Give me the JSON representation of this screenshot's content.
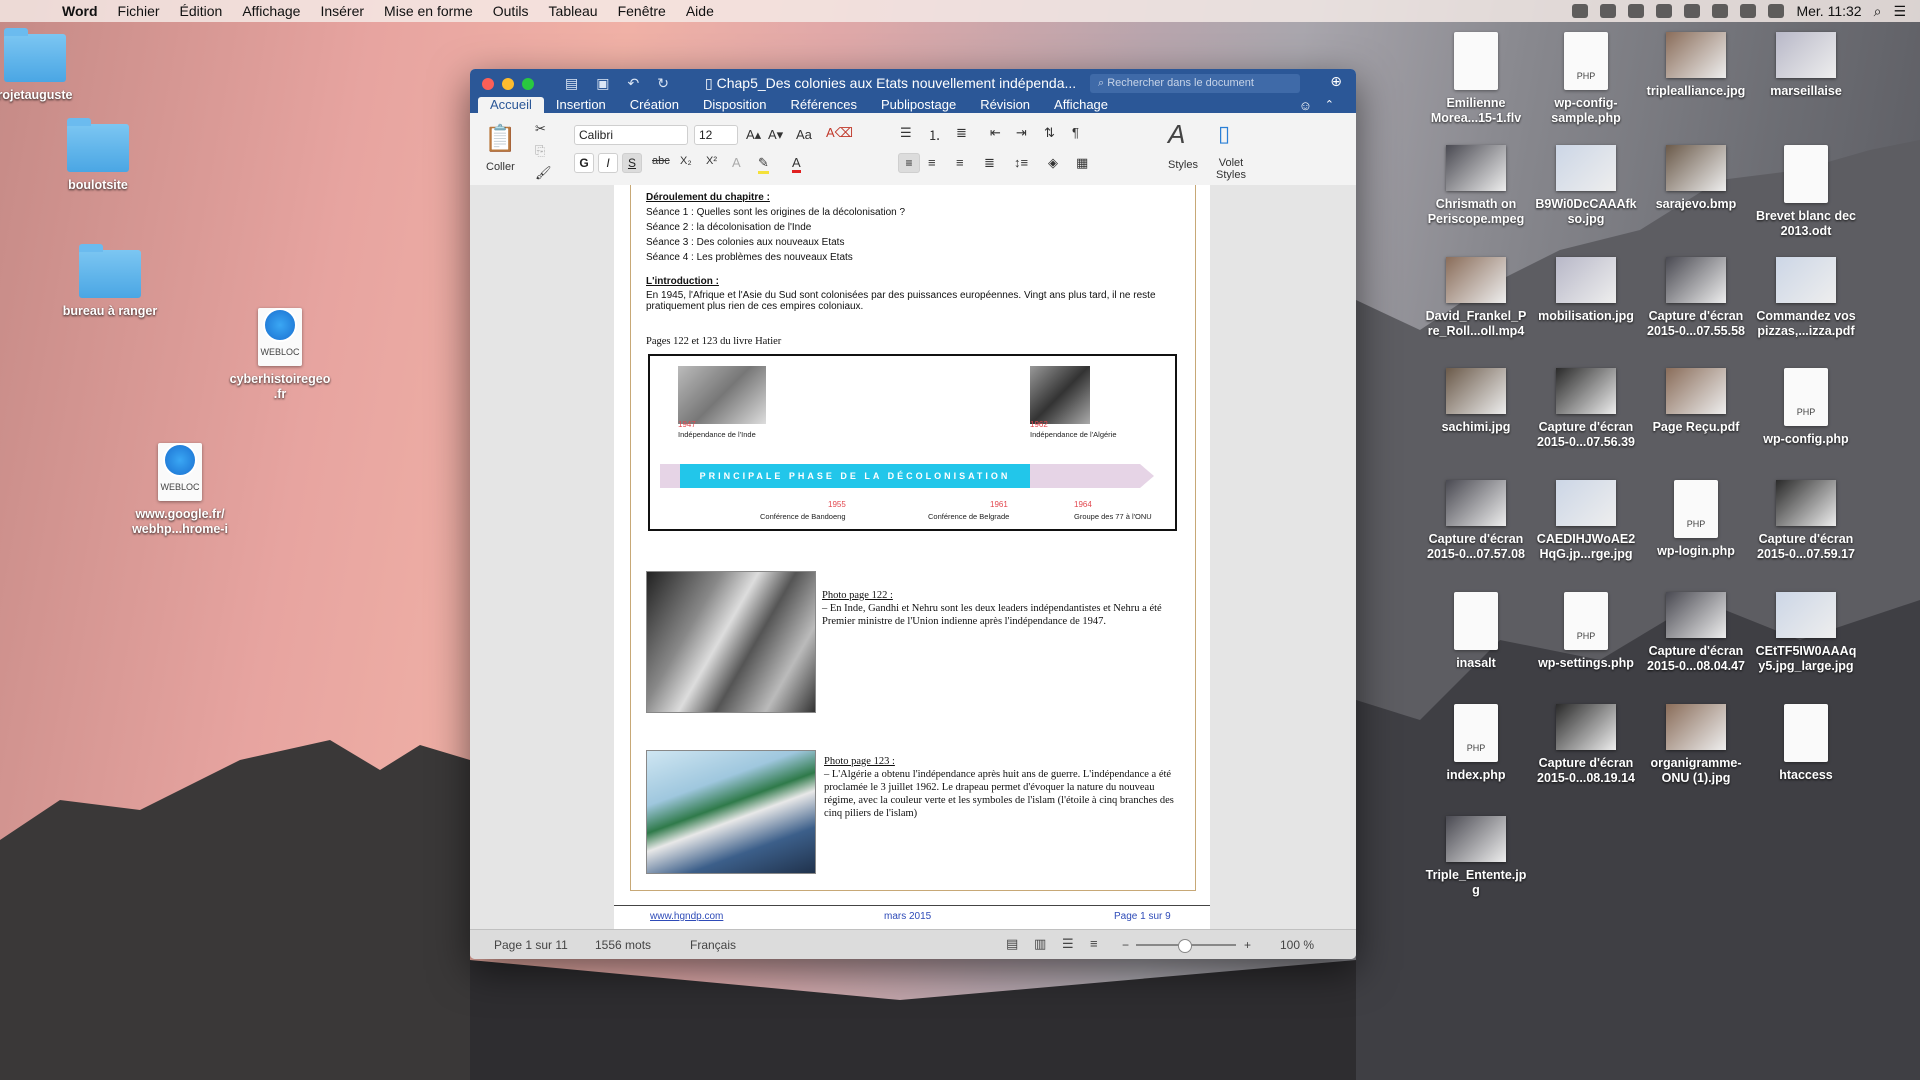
{
  "menubar": {
    "app_name": "Word",
    "items": [
      "Fichier",
      "Édition",
      "Affichage",
      "Insérer",
      "Mise en forme",
      "Outils",
      "Tableau",
      "Fenêtre",
      "Aide"
    ],
    "clock": "Mer. 11:32"
  },
  "desktop_left": [
    {
      "label": "rojetauguste",
      "kind": "folder"
    },
    {
      "label": "boulotsite",
      "kind": "folder"
    },
    {
      "label": "bureau à ranger",
      "kind": "folder"
    },
    {
      "label": "cyberhistoiregeo\n.fr",
      "kind": "webloc",
      "tag": "WEBLOC"
    },
    {
      "label": "www.google.fr/\nwebhp...hrome-i",
      "kind": "webloc",
      "tag": "WEBLOC"
    }
  ],
  "desktop_right": [
    {
      "label": "Emilienne\nMorea...15-1.flv",
      "kind": "doc"
    },
    {
      "label": "wp-config-\nsample.php",
      "kind": "doc",
      "tag": "PHP"
    },
    {
      "label": "triplealliance.jpg",
      "kind": "img"
    },
    {
      "label": "marseillaise",
      "kind": "img"
    },
    {
      "label": "Chrismath on\nPeriscope.mpeg",
      "kind": "img"
    },
    {
      "label": "B9Wi0DcCAAAfk\nso.jpg",
      "kind": "img"
    },
    {
      "label": "sarajevo.bmp",
      "kind": "img"
    },
    {
      "label": "Brevet blanc dec\n2013.odt",
      "kind": "doc"
    },
    {
      "label": "David_Frankel_P\nre_Roll...oll.mp4",
      "kind": "img"
    },
    {
      "label": "mobilisation.jpg",
      "kind": "img"
    },
    {
      "label": "Capture d'écran\n2015-0...07.55.58",
      "kind": "img"
    },
    {
      "label": "Commandez vos\npizzas,...izza.pdf",
      "kind": "img"
    },
    {
      "label": "sachimi.jpg",
      "kind": "img"
    },
    {
      "label": "Capture d'écran\n2015-0...07.56.39",
      "kind": "img"
    },
    {
      "label": "Page Reçu.pdf",
      "kind": "img"
    },
    {
      "label": "wp-config.php",
      "kind": "doc",
      "tag": "PHP"
    },
    {
      "label": "Capture d'écran\n2015-0...07.57.08",
      "kind": "img"
    },
    {
      "label": "CAEDIHJWoAE2\nHqG.jp...rge.jpg",
      "kind": "img"
    },
    {
      "label": "wp-login.php",
      "kind": "doc",
      "tag": "PHP"
    },
    {
      "label": "Capture d'écran\n2015-0...07.59.17",
      "kind": "img"
    },
    {
      "label": "inasalt",
      "kind": "doc"
    },
    {
      "label": "wp-settings.php",
      "kind": "doc",
      "tag": "PHP"
    },
    {
      "label": "Capture d'écran\n2015-0...08.04.47",
      "kind": "img"
    },
    {
      "label": "CEtTF5IW0AAAq\ny5.jpg_large.jpg",
      "kind": "img"
    },
    {
      "label": "index.php",
      "kind": "doc",
      "tag": "PHP"
    },
    {
      "label": "Capture d'écran\n2015-0...08.19.14",
      "kind": "img"
    },
    {
      "label": "organigramme-\nONU (1).jpg",
      "kind": "img"
    },
    {
      "label": "htaccess",
      "kind": "doc"
    },
    {
      "label": "Triple_Entente.jp\ng",
      "kind": "img"
    }
  ],
  "window": {
    "title": "Chap5_Des colonies aux Etats nouvellement indépenda...",
    "search_placeholder": "Rechercher dans le document",
    "tabs": [
      "Accueil",
      "Insertion",
      "Création",
      "Disposition",
      "Références",
      "Publipostage",
      "Révision",
      "Affichage"
    ],
    "ribbon": {
      "paste_label": "Coller",
      "font_name": "Calibri",
      "font_size": "12",
      "styles_label": "Styles",
      "pane_label": "Volet\nStyles"
    }
  },
  "document": {
    "deroulement_title": "Déroulement du chapitre :",
    "seances": [
      "Séance 1 : Quelles sont les origines de la décolonisation ?",
      "Séance 2 : la décolonisation de l'Inde",
      "Séance 3 : Des colonies aux nouveaux Etats",
      "Séance 4 : Les problèmes des nouveaux Etats"
    ],
    "intro_title": "L'introduction :",
    "intro_text": "En 1945, l'Afrique et l'Asie du Sud sont colonisées par des puissances européennes. Vingt ans plus tard, il ne reste pratiquement plus rien de ces empires coloniaux.",
    "pages_ref": "Pages 122 et 123 du livre Hatier",
    "timeline": {
      "bar_label": "PRINCIPALE PHASE DE LA DÉCOLONISATION",
      "top_events": [
        {
          "year": "1947",
          "label": "Indépendance de l'Inde"
        },
        {
          "year": "1962",
          "label": "Indépendance de l'Algérie"
        }
      ],
      "bottom_events": [
        {
          "year": "1955",
          "label": "Conférence de Bandoeng"
        },
        {
          "year": "1961",
          "label": "Conférence de Belgrade"
        },
        {
          "year": "1964",
          "label": "Groupe des 77 à l'ONU"
        }
      ]
    },
    "photo122_title": "Photo page 122 :",
    "photo122_text": "– En Inde, Gandhi et Nehru sont les deux leaders indépendantistes et Nehru a été Premier ministre de l'Union indienne après l'indépendance de 1947.",
    "photo123_title": "Photo page 123 :",
    "photo123_text": "– L'Algérie a obtenu l'indépendance après huit ans de guerre. L'indépendance a été proclamée le 3 juillet 1962. Le drapeau permet d'évoquer la nature du nouveau régime, avec la couleur verte et les symboles de l'islam (l'étoile à cinq branches des cinq piliers de l'islam)",
    "footer_left": "www.hgndp.com",
    "footer_center": "mars 2015",
    "footer_right": "Page 1 sur 9"
  },
  "statusbar": {
    "page": "Page 1 sur 11",
    "words": "1556 mots",
    "language": "Français",
    "zoom": "100 %"
  }
}
